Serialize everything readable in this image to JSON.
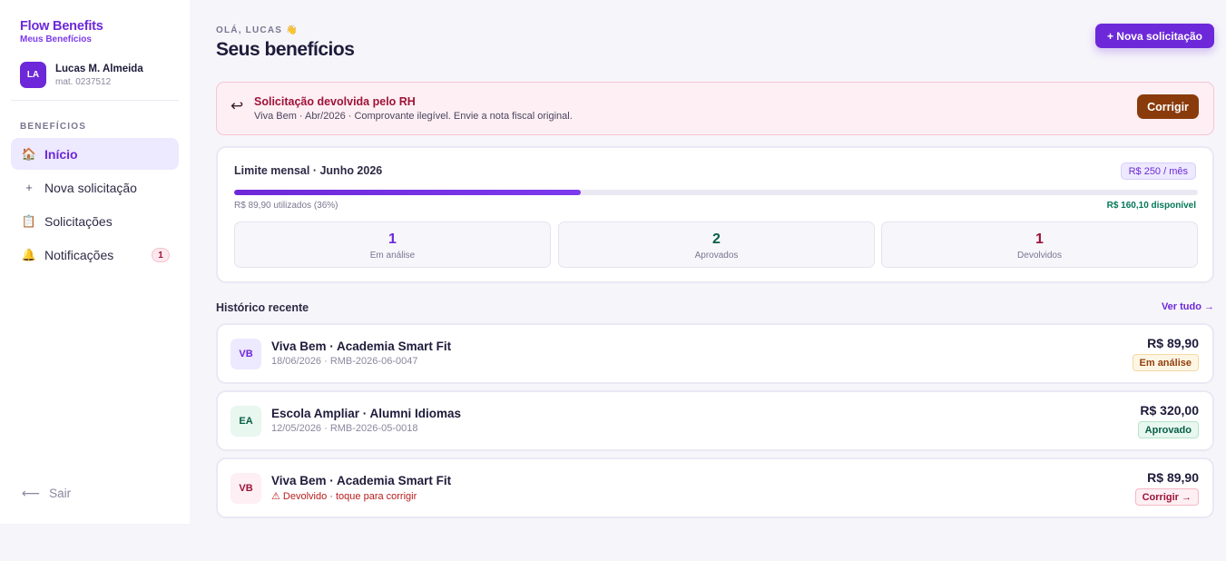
{
  "brand": {
    "title": "Flow Benefits",
    "subtitle": "Meus Benefícios"
  },
  "user": {
    "initials": "LA",
    "name": "Lucas M. Almeida",
    "mat": "mat. 0237512"
  },
  "sidebar": {
    "section_label": "BENEFÍCIOS",
    "items": [
      {
        "label": "Início",
        "icon": "home-icon",
        "glyph": "🏠",
        "active": true
      },
      {
        "label": "Nova solicitação",
        "icon": "plus-icon",
        "glyph": "+",
        "active": false
      },
      {
        "label": "Solicitações",
        "icon": "clipboard-icon",
        "glyph": "📋",
        "active": false
      },
      {
        "label": "Notificações",
        "icon": "bell-icon",
        "glyph": "🔔",
        "active": false,
        "badge": "1"
      }
    ],
    "logout": {
      "label": "Sair",
      "icon": "arrow-left-icon",
      "glyph": "⟵"
    }
  },
  "header": {
    "greeting": "OLÁ, LUCAS 👋",
    "title": "Seus benefícios",
    "new_button": "+ Nova solicitação"
  },
  "alert": {
    "icon": "return-arrow-icon",
    "glyph": "↩",
    "title": "Solicitação devolvida pelo RH",
    "text": "Viva Bem · Abr/2026 · Comprovante ilegível. Envie a nota fiscal original.",
    "button": "Corrigir"
  },
  "limit": {
    "title": "Limite mensal · Junho 2026",
    "badge": "R$ 250 / mês",
    "used_text": "R$ 89,90 utilizados (36%)",
    "available_text": "R$ 160,10 disponível",
    "progress": 0.36,
    "stats": [
      {
        "value": "1",
        "label": "Em análise",
        "color": "#6d28d9"
      },
      {
        "value": "2",
        "label": "Aprovados",
        "color": "#065f46"
      },
      {
        "value": "1",
        "label": "Devolvidos",
        "color": "#9f1239"
      }
    ]
  },
  "history": {
    "title": "Histórico recente",
    "see_all": "Ver tudo →",
    "rows": [
      {
        "initials": "VB",
        "title": "Viva Bem · Academia Smart Fit",
        "sub": "18/06/2026 · RMB-2026-06-0047",
        "amount": "R$ 89,90",
        "status": "Em análise",
        "avatar_bg": "#ede9fe",
        "avatar_fg": "#6d28d9",
        "badge_bg": "#fef6e4",
        "badge_border": "#f3d9a4",
        "badge_fg": "#92400e"
      },
      {
        "initials": "EA",
        "title": "Escola Ampliar · Alumni Idiomas",
        "sub": "12/05/2026 · RMB-2026-05-0018",
        "amount": "R$ 320,00",
        "status": "Aprovado",
        "avatar_bg": "#e8f7ef",
        "avatar_fg": "#065f46",
        "badge_bg": "#e8f7ef",
        "badge_border": "#b7e4c9",
        "badge_fg": "#065f46"
      },
      {
        "initials": "VB",
        "title": "Viva Bem · Academia Smart Fit",
        "sub": "⚠ Devolvido · toque para corrigir",
        "amount": "R$ 89,90",
        "status": "Corrigir →",
        "avatar_bg": "#fdeff3",
        "avatar_fg": "#9f1239",
        "badge_bg": "#fdeff3",
        "badge_border": "#f5b8c8",
        "badge_fg": "#9f1239"
      }
    ]
  }
}
